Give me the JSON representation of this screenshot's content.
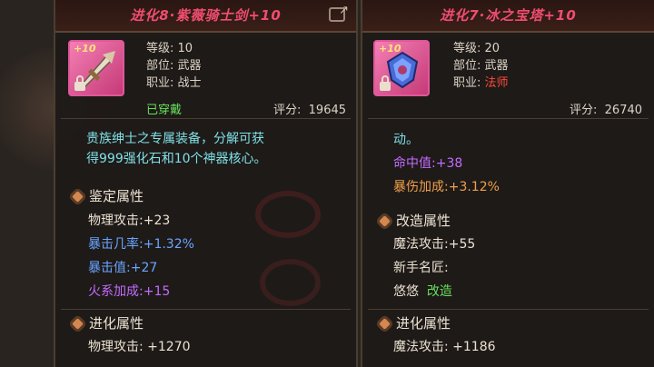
{
  "colors": {
    "title": "#ef4d6f",
    "equipped": "#66e05a",
    "class_mage": "#ff4a3a",
    "desc": "#7fe0e6"
  },
  "left": {
    "title": "进化8·紫薇骑士剑+10",
    "icon": "sword-icon",
    "badge": "+10",
    "level_label": "等级:",
    "level": "10",
    "slot_label": "部位:",
    "slot": "武器",
    "class_label": "职业:",
    "class": "战士",
    "status": "已穿戴",
    "score_label": "评分:",
    "score": "19645",
    "desc_line1": "贵族绅士之专属装备，分解可获",
    "desc_line2": "得999强化石和10个神器核心。",
    "appraisal_title": "鉴定属性",
    "appraisal": [
      {
        "name": "物理攻击:",
        "value": "+23"
      },
      {
        "name": "暴击几率:",
        "value": "+1.32%"
      },
      {
        "name": "暴击值:",
        "value": "+27"
      },
      {
        "name": "火系加成:",
        "value": "+15"
      }
    ],
    "evolve_title": "进化属性",
    "evolve": [
      {
        "name": "物理攻击:",
        "value": "+1270"
      }
    ]
  },
  "right": {
    "title": "进化7·冰之宝塔+10",
    "icon": "armor-icon",
    "badge": "+10",
    "level_label": "等级:",
    "level": "20",
    "slot_label": "部位:",
    "slot": "武器",
    "class_label": "职业:",
    "class": "法师",
    "score_label": "评分:",
    "score": "26740",
    "desc_line1": "动。",
    "stats": [
      {
        "name": "命中值:",
        "value": "+38"
      },
      {
        "name": "暴伤加成:",
        "value": "+3.12%"
      }
    ],
    "modify_title": "改造属性",
    "modify": [
      {
        "name": "魔法攻击:",
        "value": "+55"
      },
      {
        "name": "新手名匠:",
        "value": ""
      },
      {
        "name": "悠悠",
        "value": "改造"
      }
    ],
    "evolve_title": "进化属性",
    "evolve": [
      {
        "name": "魔法攻击:",
        "value": "+1186"
      }
    ]
  }
}
